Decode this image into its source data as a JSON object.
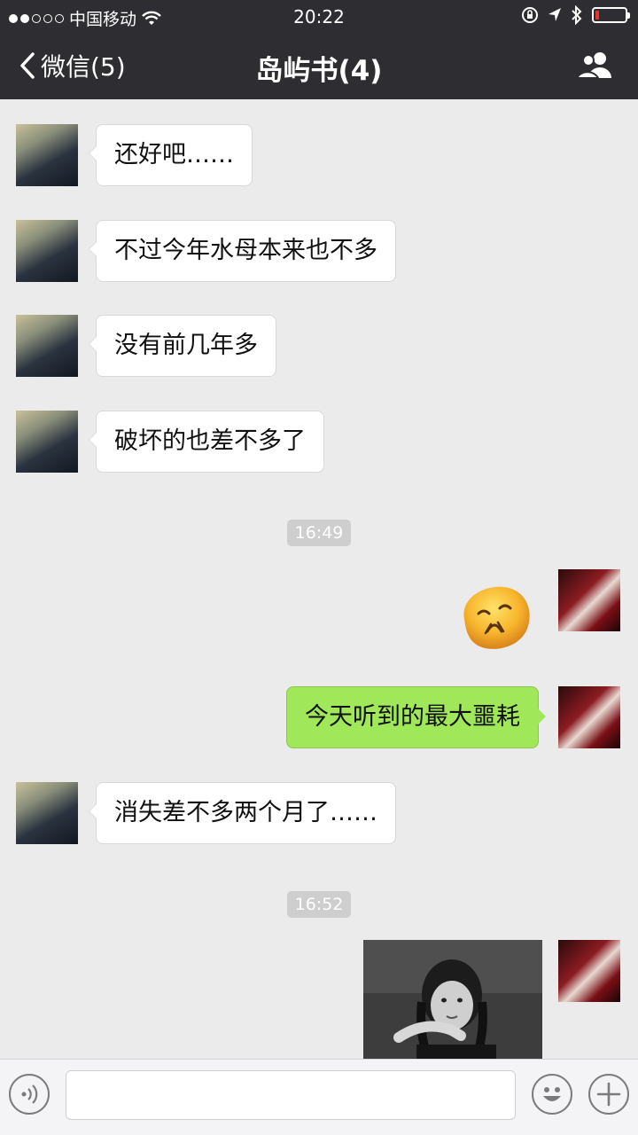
{
  "status_bar": {
    "carrier": "中国移动",
    "time": "20:22",
    "signal_bars_filled": 2,
    "signal_bars_total": 5,
    "battery_level": 0.12
  },
  "nav": {
    "back_label": "微信(5)",
    "title": "岛屿书(4)",
    "icons": {
      "back": "chevron-left-icon",
      "people": "group-members-icon"
    }
  },
  "messages": [
    {
      "from": "other",
      "text": "还好吧……"
    },
    {
      "from": "other",
      "text": "不过今年水母本来也不多"
    },
    {
      "from": "other",
      "text": "没有前几年多"
    },
    {
      "from": "other",
      "text": "破坏的也差不多了"
    },
    {
      "type": "timestamp",
      "text": "16:49"
    },
    {
      "from": "me",
      "type": "emoji",
      "emoji": "crying-face-emoji"
    },
    {
      "from": "me",
      "text": "今天听到的最大噩耗"
    },
    {
      "from": "other",
      "text": "消失差不多两个月了……"
    },
    {
      "type": "timestamp",
      "text": "16:52"
    },
    {
      "from": "me",
      "type": "image",
      "content": "black-and-white gif of girl with braids"
    }
  ],
  "input_bar": {
    "value": "",
    "icons": {
      "voice": "voice-input-icon",
      "emoji": "emoji-picker-icon",
      "more": "plus-icon"
    }
  },
  "colors": {
    "header_bg": "#2e2e32",
    "chat_bg": "#ebebeb",
    "bubble_me": "#a0e75a",
    "bubble_other": "#ffffff",
    "battery_low": "#e8352b"
  }
}
